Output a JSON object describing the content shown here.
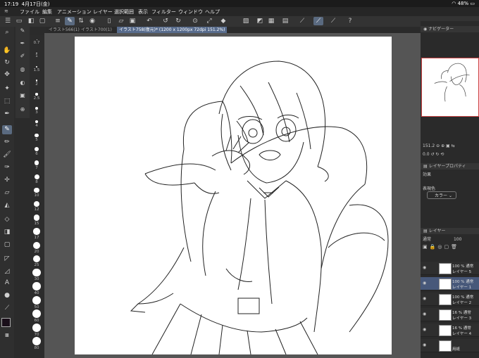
{
  "status": {
    "time": "17:19",
    "date": "4月17日(金)",
    "battery": "48%"
  },
  "menu": [
    "ファイル",
    "編集",
    "アニメーション",
    "レイヤー",
    "選択範囲",
    "表示",
    "フィルター",
    "ウィンドウ",
    "ヘルプ"
  ],
  "tabs": [
    {
      "label": "イラスト566(1)"
    },
    {
      "label": "イラスト700(1)"
    },
    {
      "label": "イラスト758(復元)* (1200 x 1200px 72dpi 151.2%)"
    }
  ],
  "brush_sizes": [
    "0.7",
    "1",
    "1.5",
    "2",
    "2.5",
    "3",
    "4",
    "5",
    "6",
    "7",
    "8",
    "10",
    "12",
    "15",
    "17",
    "20",
    "25",
    "30",
    "40",
    "50",
    "60",
    "70",
    "80"
  ],
  "navigator": {
    "title": "ナビゲーター",
    "zoom": "151.2",
    "angle": "0.0"
  },
  "layer_property": {
    "title": "レイヤープロパティ",
    "effect_label": "効果",
    "color_label": "表現色",
    "color_value": "カラー"
  },
  "layers_panel": {
    "title": "レイヤー",
    "blend": "通常",
    "opacity": "100"
  },
  "layers": [
    {
      "opacity": "100 %",
      "mode": "通常",
      "name": "レイヤー 5",
      "selected": false
    },
    {
      "opacity": "100 %",
      "mode": "通常",
      "name": "レイヤー 1",
      "selected": true
    },
    {
      "opacity": "100 %",
      "mode": "通常",
      "name": "レイヤー 2",
      "selected": false
    },
    {
      "opacity": "16 %",
      "mode": "通常",
      "name": "レイヤー 3",
      "selected": false
    },
    {
      "opacity": "16 %",
      "mode": "通常",
      "name": "レイヤー 4",
      "selected": false
    },
    {
      "opacity": "",
      "mode": "",
      "name": "用紙",
      "selected": false
    }
  ],
  "colors": {
    "main": "#1a0f1a",
    "sub": "#ffffff",
    "accent": "#576b8c"
  }
}
